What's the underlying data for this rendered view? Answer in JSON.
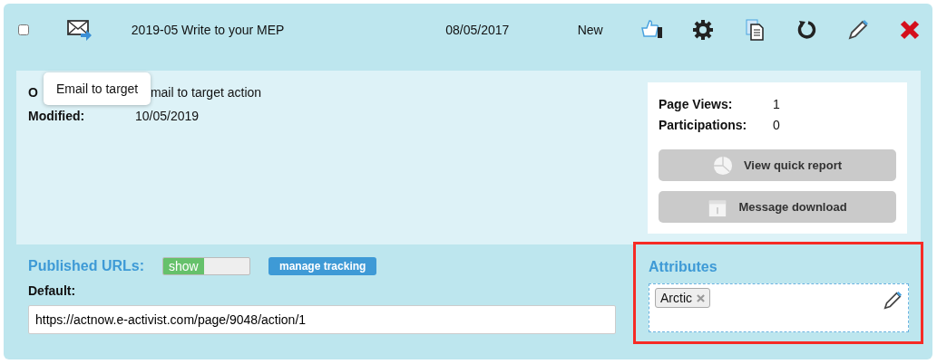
{
  "row": {
    "checked": false,
    "title": "2019-05 Write to your MEP",
    "date": "08/05/2017",
    "status": "New",
    "actions": [
      {
        "kind": "like"
      },
      {
        "kind": "settings"
      },
      {
        "kind": "copy"
      },
      {
        "kind": "refresh"
      },
      {
        "kind": "edit"
      },
      {
        "kind": "delete"
      }
    ]
  },
  "tooltip": {
    "text": "Email to target"
  },
  "details": [
    {
      "label": "O",
      "value": "mail to target action"
    },
    {
      "label": "Modified:",
      "value": "10/05/2019"
    }
  ],
  "stats": [
    {
      "label": "Page Views:",
      "value": "1"
    },
    {
      "label": "Participations:",
      "value": "0"
    }
  ],
  "report_buttons": [
    {
      "kind": "chart",
      "label": "View quick report"
    },
    {
      "kind": "calendar",
      "label": "Message download"
    }
  ],
  "published_urls": {
    "title": "Published URLs:",
    "toggle": {
      "label": "show",
      "on": true
    },
    "tracking_button": "manage tracking",
    "default_label": "Default:",
    "default_url": "https://actnow.e-activist.com/page/9048/action/1"
  },
  "attributes": {
    "title": "Attributes",
    "highlighted": true,
    "tags": [
      {
        "label": "Arctic"
      }
    ]
  }
}
